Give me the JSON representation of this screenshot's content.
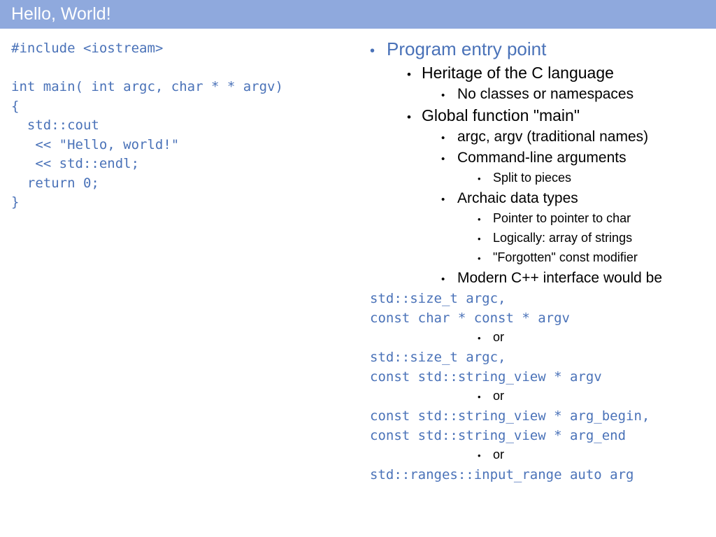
{
  "slide": {
    "title": "Hello, World!",
    "title_bar_color": "#8fa9dd",
    "title_text_color": "#ffffff",
    "code_color": "#4a72b8",
    "accent_color": "#4a72b8",
    "body_text_color": "#000000",
    "background_color": "#ffffff"
  },
  "code_panel": {
    "lines": [
      "#include <iostream>",
      "",
      "int main( int argc, char * * argv)",
      "{",
      "  std::cout",
      "   << \"Hello, world!\"",
      "   << std::endl;",
      "  return 0;",
      "}"
    ]
  },
  "bullets": {
    "bullet_glyph": "•",
    "items": [
      {
        "level": 1,
        "text": "Program entry point"
      },
      {
        "level": 2,
        "text": "Heritage of the C language"
      },
      {
        "level": 3,
        "text": "No classes or namespaces"
      },
      {
        "level": 2,
        "text": "Global function \"main\""
      },
      {
        "level": 3,
        "text": "argc, argv (traditional names)"
      },
      {
        "level": 3,
        "text": "Command-line arguments"
      },
      {
        "level": 4,
        "text": "Split to pieces"
      },
      {
        "level": 3,
        "text": "Archaic data types"
      },
      {
        "level": 4,
        "text": "Pointer to pointer to char"
      },
      {
        "level": 4,
        "text": "Logically: array of strings"
      },
      {
        "level": 4,
        "text": "\"Forgotten\" const modifier"
      },
      {
        "level": 3,
        "text": "Modern C++ interface would be"
      },
      {
        "level": "code",
        "text": "std::size_t argc,"
      },
      {
        "level": "code",
        "text": "const char * const * argv"
      },
      {
        "level": 4,
        "text": "or"
      },
      {
        "level": "code",
        "text": "std::size_t argc,"
      },
      {
        "level": "code",
        "text": "const std::string_view * argv"
      },
      {
        "level": 4,
        "text": "or"
      },
      {
        "level": "code",
        "text": "const std::string_view * arg_begin,"
      },
      {
        "level": "code",
        "text": "const std::string_view * arg_end"
      },
      {
        "level": 4,
        "text": "or"
      },
      {
        "level": "code",
        "text": "std::ranges::input_range auto arg"
      }
    ]
  }
}
